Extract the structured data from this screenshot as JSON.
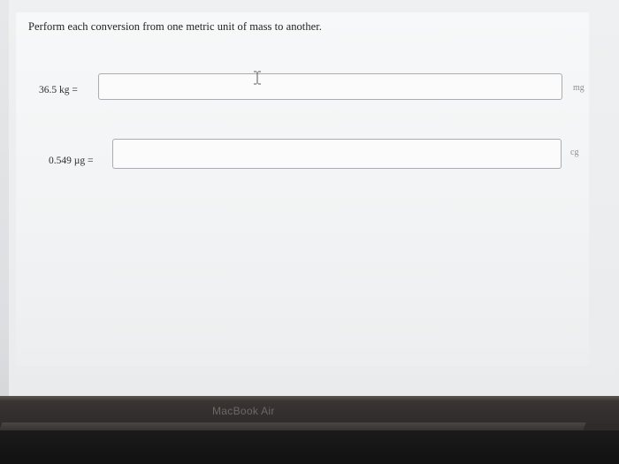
{
  "instruction": "Perform each conversion from one metric unit of mass to another.",
  "problems": [
    {
      "label": "36.5 kg =",
      "value": "",
      "unit": "mg"
    },
    {
      "label": "0.549 µg =",
      "value": "",
      "unit": "cg"
    }
  ],
  "device": {
    "brand": "MacBook Air"
  },
  "icons": {
    "cursor": "text-cursor-icon"
  }
}
